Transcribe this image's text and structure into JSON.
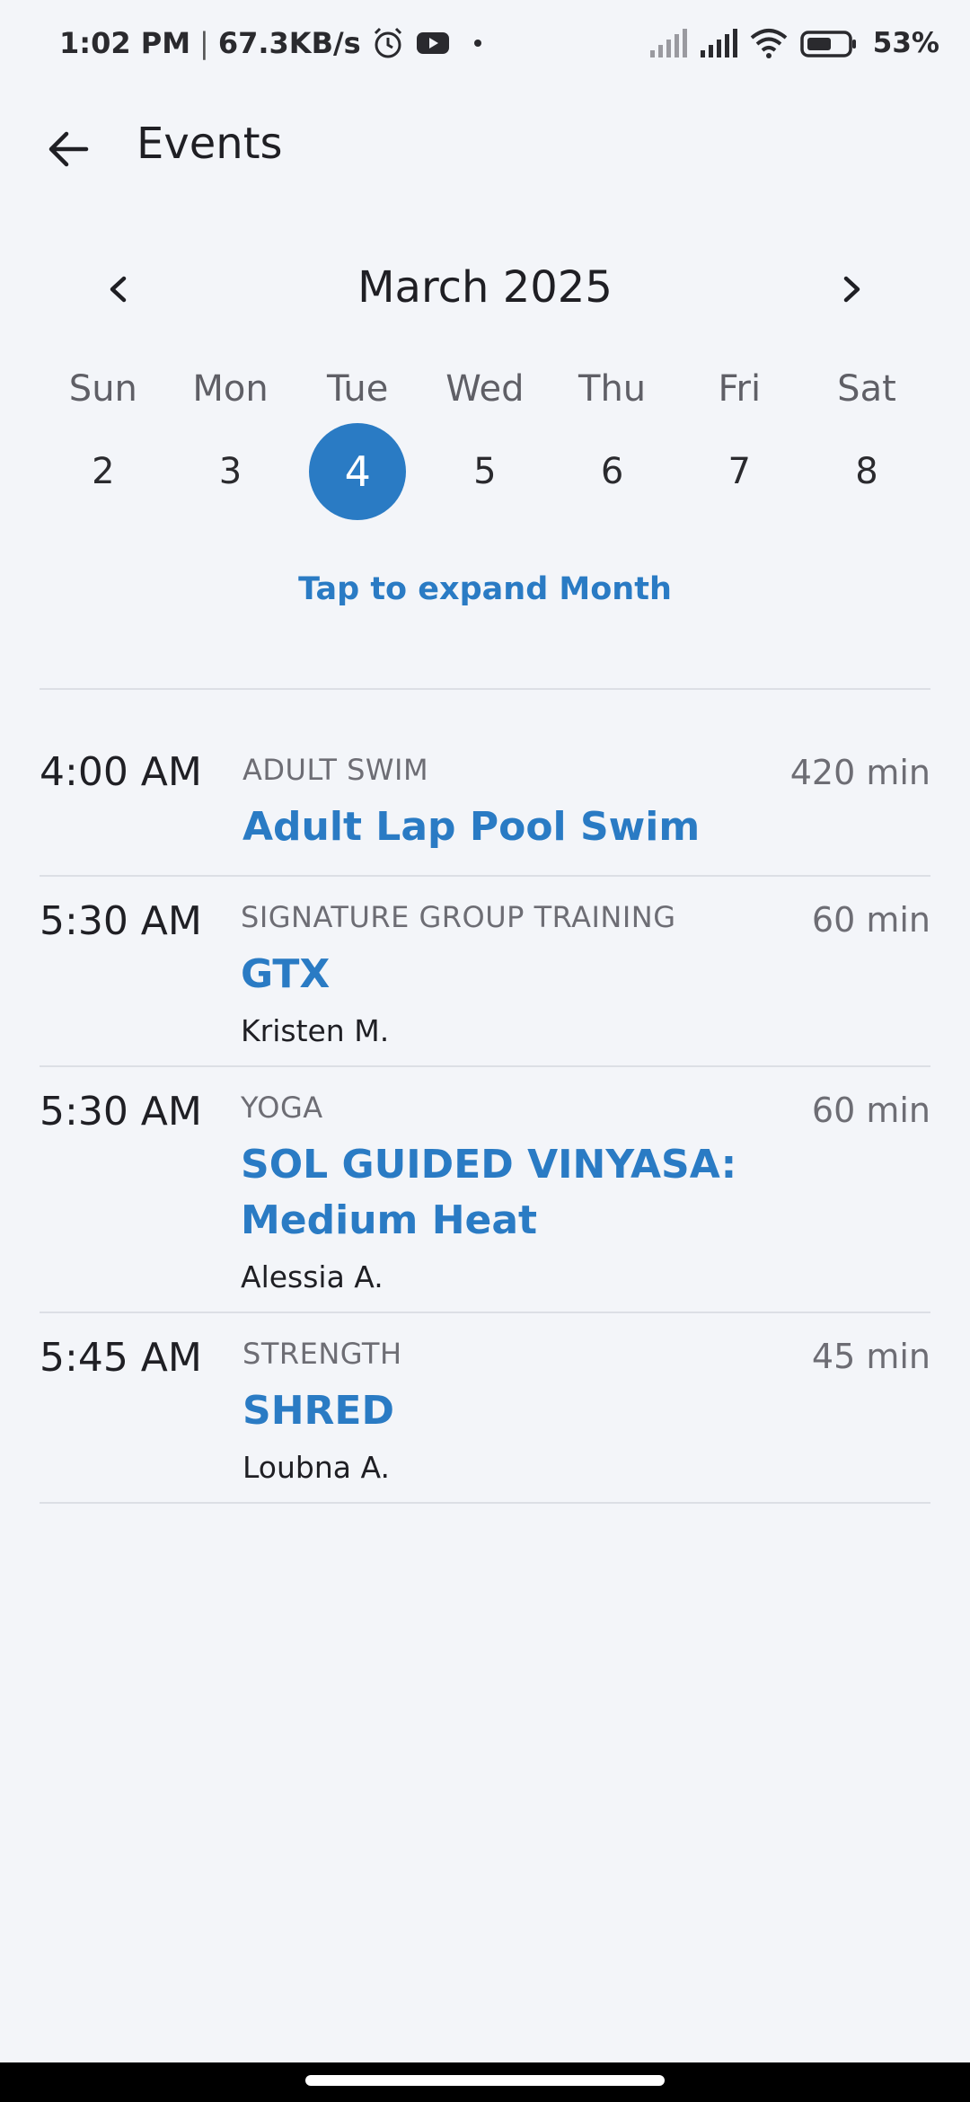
{
  "status_bar": {
    "time": "1:02 PM",
    "separator": "|",
    "network_speed": "67.3KB/s",
    "battery": "53%",
    "icons": [
      "alarm-icon",
      "youtube-icon",
      "dot-icon",
      "signal-icon",
      "signal-icon",
      "wifi-icon",
      "battery-icon"
    ]
  },
  "appbar": {
    "title": "Events",
    "back_icon": "arrow-left-icon"
  },
  "calendar": {
    "month_label": "March 2025",
    "prev_icon": "chevron-left-icon",
    "next_icon": "chevron-right-icon",
    "weekdays": [
      "Sun",
      "Mon",
      "Tue",
      "Wed",
      "Thu",
      "Fri",
      "Sat"
    ],
    "days": [
      "2",
      "3",
      "4",
      "5",
      "6",
      "7",
      "8"
    ],
    "selected_day": "4",
    "expand_label": "Tap to expand Month",
    "accent_color": "#2a7bc4"
  },
  "events": [
    {
      "time": "4:00 AM",
      "category": "ADULT SWIM",
      "name": "Adult Lap Pool Swim",
      "duration": "420 min",
      "instructor": ""
    },
    {
      "time": "5:30 AM",
      "category": "SIGNATURE GROUP TRAINING",
      "name": "GTX",
      "duration": "60 min",
      "instructor": "Kristen M."
    },
    {
      "time": "5:30 AM",
      "category": "YOGA",
      "name": "SOL GUIDED VINYASA: Medium Heat",
      "duration": "60 min",
      "instructor": "Alessia A."
    },
    {
      "time": "5:45 AM",
      "category": "STRENGTH",
      "name": "SHRED",
      "duration": "45 min",
      "instructor": "Loubna A."
    }
  ]
}
